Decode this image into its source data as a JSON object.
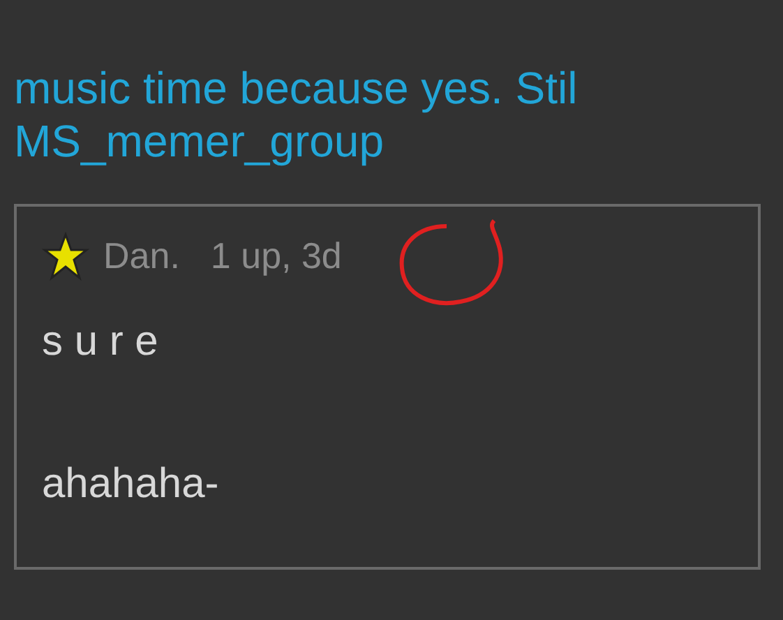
{
  "post": {
    "lines": [
      "music time because yes. Stil",
      "MS_memer_group"
    ]
  },
  "comment": {
    "author": "Dan.",
    "meta": "1 up, 3d",
    "lines": [
      "s u r e",
      "ahahaha-"
    ]
  }
}
